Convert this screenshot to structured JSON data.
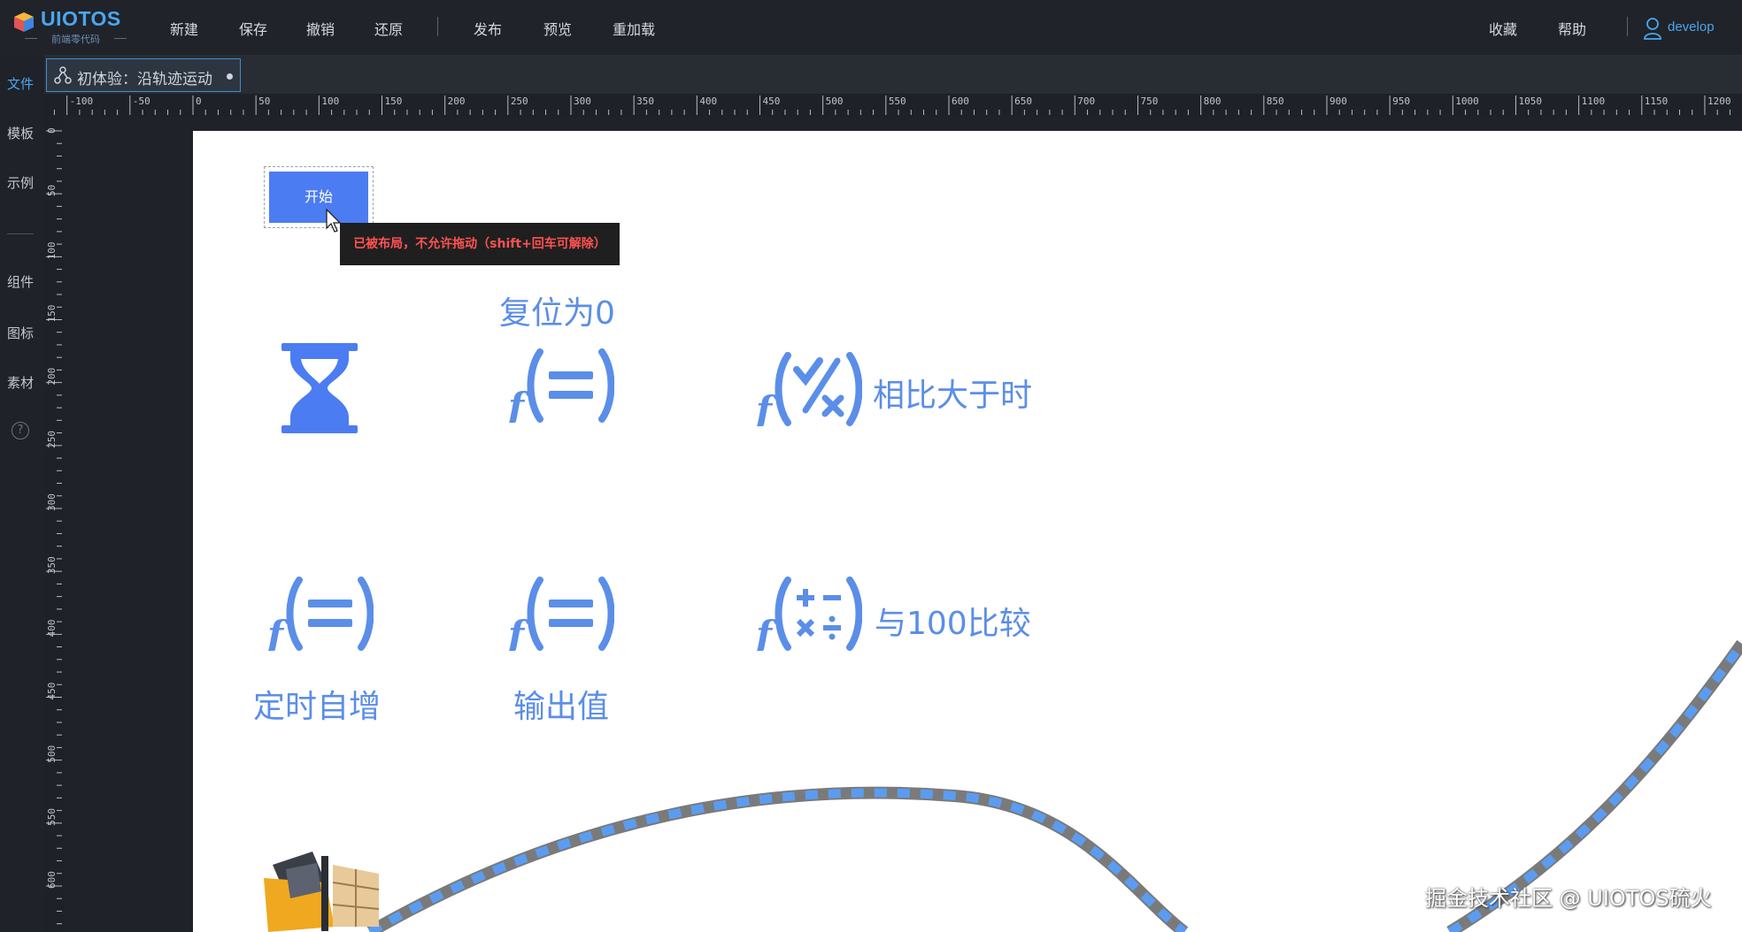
{
  "app": {
    "logo_text": "UIOTOS",
    "logo_subtitle": "前端零代码"
  },
  "menu": {
    "new": "新建",
    "save": "保存",
    "undo": "撤销",
    "redo": "还原",
    "publish": "发布",
    "preview": "预览",
    "reload": "重加载",
    "favorites": "收藏",
    "help": "帮助",
    "user": "develop"
  },
  "sidebar": {
    "items": [
      {
        "label": "文件",
        "active": true
      },
      {
        "label": "模板"
      },
      {
        "label": "示例"
      },
      {
        "label": "组件"
      },
      {
        "label": "图标"
      },
      {
        "label": "素材"
      }
    ],
    "help_glyph": "?"
  },
  "tab": {
    "label": "初体验：沿轨迹运动"
  },
  "ruler": {
    "h_labels": [
      "-100",
      "-50",
      "0",
      "50",
      "100",
      "150",
      "200",
      "250",
      "300",
      "350",
      "400",
      "450",
      "500",
      "550",
      "600",
      "650",
      "700",
      "750",
      "800",
      "850",
      "900",
      "950",
      "1000",
      "1050",
      "1100",
      "1150",
      "1200"
    ],
    "v_labels": [
      "0",
      "50",
      "100",
      "150",
      "200",
      "250",
      "300",
      "350",
      "400",
      "450",
      "500",
      "550",
      "600"
    ]
  },
  "canvas": {
    "start_button": "开始",
    "tooltip": "已被布局，不允许拖动（shift+回车可解除）",
    "nodes": {
      "reset_label": "复位为0",
      "compare_gt_label": "相比大于时",
      "timer_inc_label": "定时自增",
      "output_label": "输出值",
      "compare_100_label": "与100比较"
    },
    "icons": [
      "hourglass-icon",
      "function-equals-icon",
      "function-compare-icon",
      "function-arithmetic-icon",
      "forklift-icon"
    ],
    "accent_color": "#5b8ee8",
    "button_color": "#4c7cf2"
  },
  "watermark": "掘金技术社区 @ UIOTOS硫火"
}
